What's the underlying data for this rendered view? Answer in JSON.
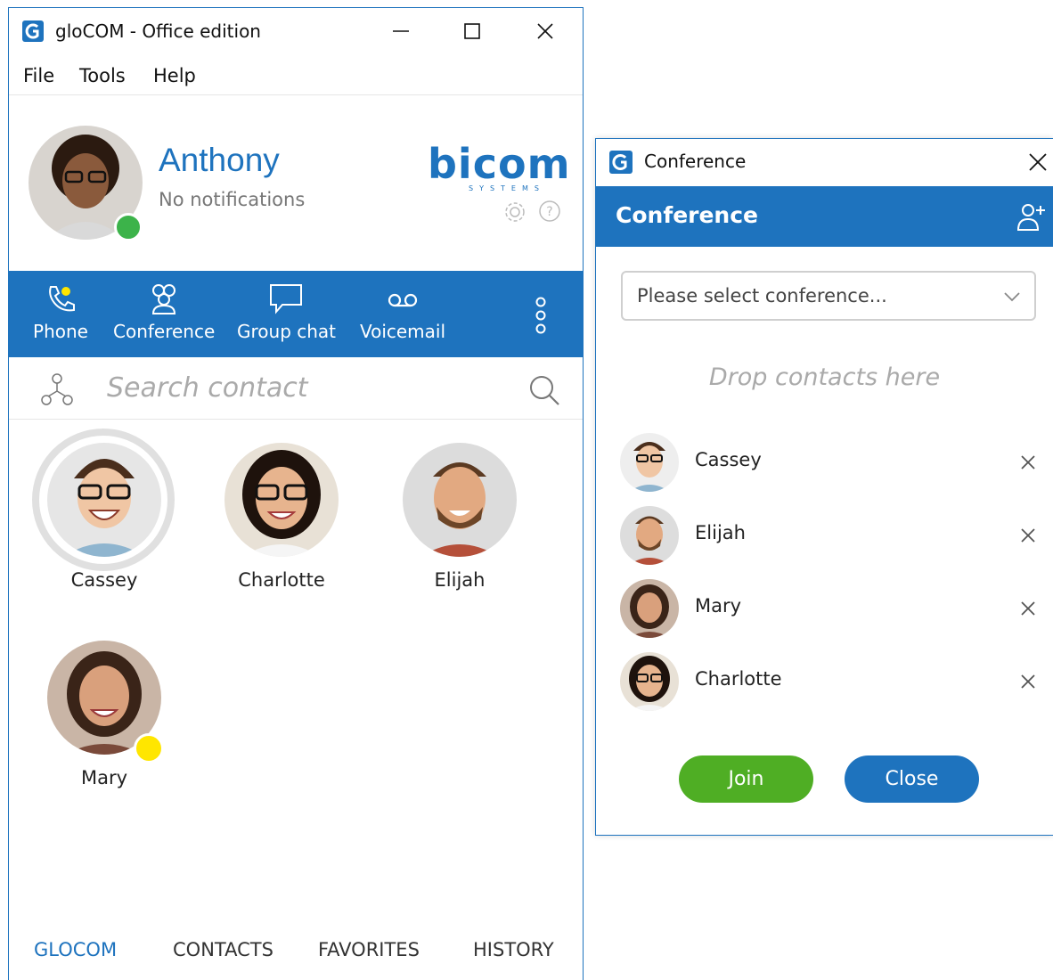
{
  "main_window": {
    "title": "gloCOM - Office edition",
    "menu": [
      "File",
      "Tools",
      "Help"
    ],
    "profile": {
      "name": "Anthony",
      "status": "No notifications",
      "presence_color": "#3cb34a",
      "brand": "bicom",
      "brand_sub": "SYSTEMS"
    },
    "nav": [
      {
        "label": "Phone",
        "icon": "phone-icon"
      },
      {
        "label": "Conference",
        "icon": "conference-icon"
      },
      {
        "label": "Group chat",
        "icon": "chat-bubble-icon"
      },
      {
        "label": "Voicemail",
        "icon": "voicemail-icon"
      }
    ],
    "search": {
      "placeholder": "Search contact"
    },
    "contacts": [
      {
        "name": "Cassey",
        "selected": true
      },
      {
        "name": "Charlotte"
      },
      {
        "name": "Elijah"
      },
      {
        "name": "Mary",
        "presence_color": "#ffe600"
      }
    ],
    "bottom_tabs": [
      {
        "label": "GLOCOM",
        "active": true
      },
      {
        "label": "CONTACTS"
      },
      {
        "label": "FAVORITES"
      },
      {
        "label": "HISTORY"
      }
    ]
  },
  "conference_window": {
    "title": "Conference",
    "heading": "Conference",
    "select_placeholder": "Please select conference...",
    "drop_hint": "Drop contacts here",
    "participants": [
      {
        "name": "Cassey"
      },
      {
        "name": "Elijah"
      },
      {
        "name": "Mary"
      },
      {
        "name": "Charlotte"
      }
    ],
    "join_label": "Join",
    "close_label": "Close"
  },
  "colors": {
    "accent": "#1e73be",
    "join": "#4fae24"
  }
}
